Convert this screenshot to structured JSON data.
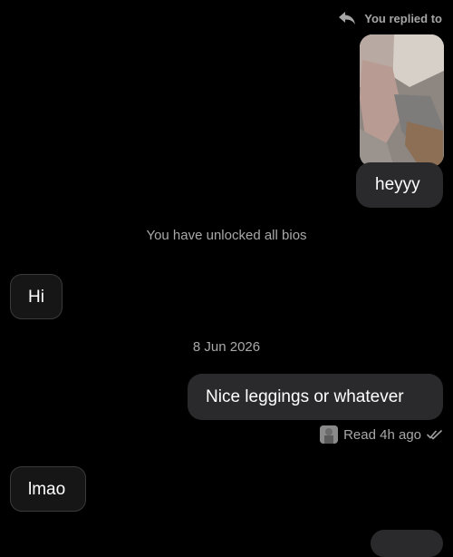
{
  "thread": {
    "reply_header": "You replied to",
    "unlocked_notice": "You have unlocked all bios",
    "date_separator": "8 Jun 2026",
    "read_status": "Read 4h ago",
    "messages": [
      {
        "side": "outgoing",
        "text": "heyyy"
      },
      {
        "side": "incoming",
        "text": "Hi"
      },
      {
        "side": "outgoing",
        "text": "Nice leggings or whatever"
      },
      {
        "side": "incoming",
        "text": "lmao"
      }
    ],
    "icons": {
      "reply": "reply-icon",
      "read_check": "double-check-icon"
    },
    "colors": {
      "background": "#000000",
      "outgoing_bubble": "#2A2A2C",
      "incoming_bubble": "#161616",
      "muted_text": "#A8A8A8"
    }
  }
}
